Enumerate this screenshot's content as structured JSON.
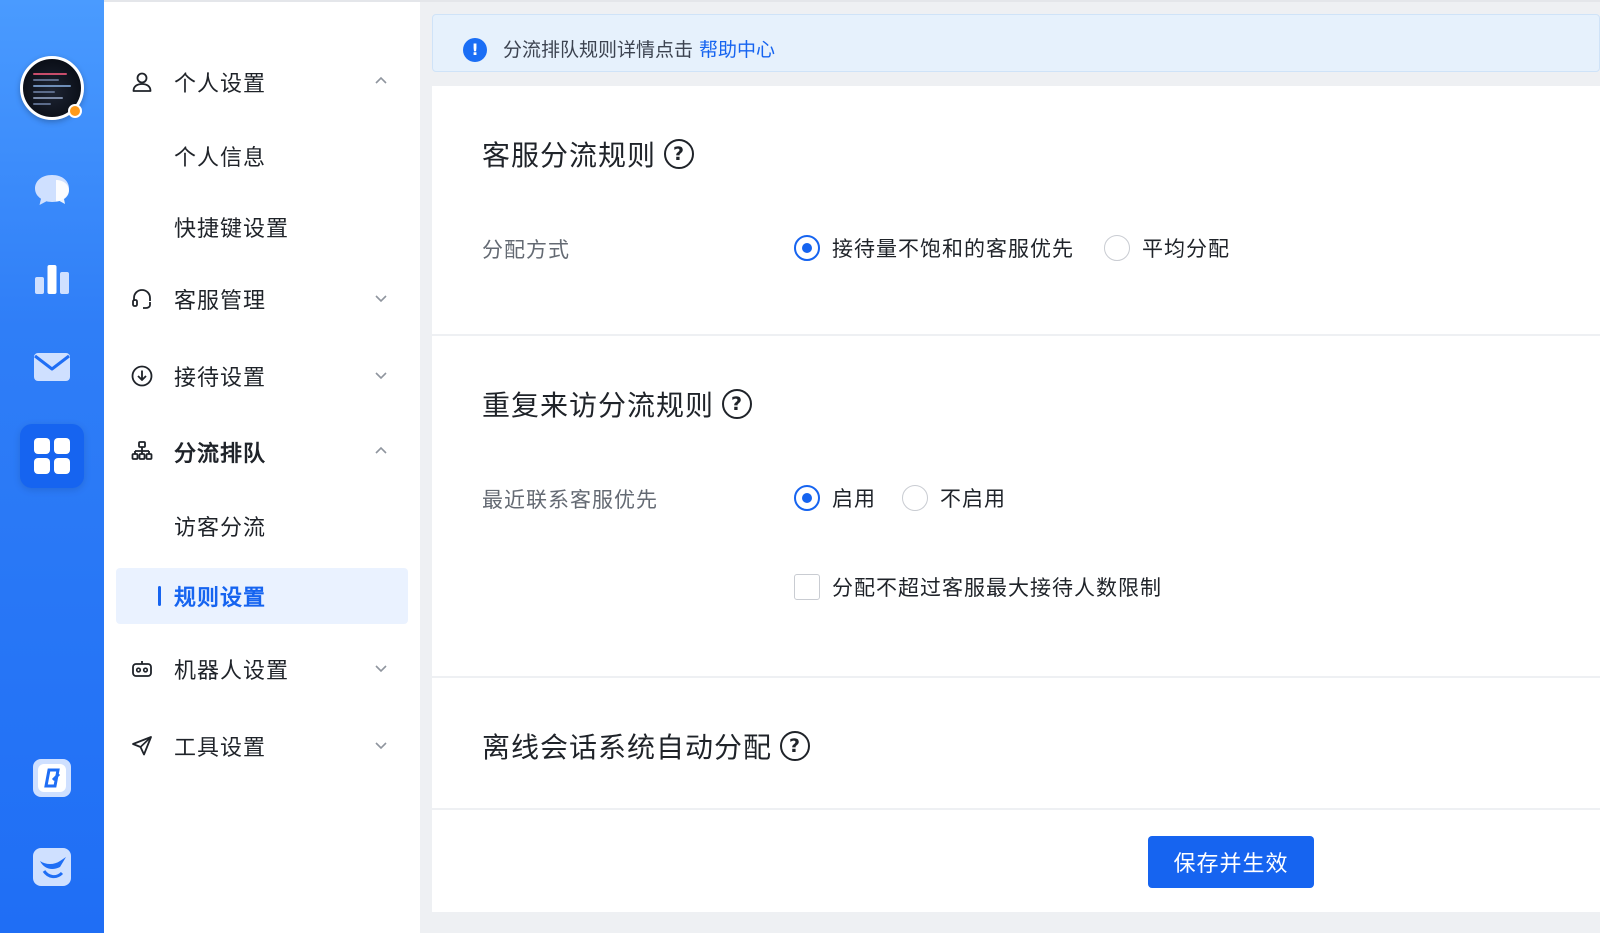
{
  "nav_rail": {
    "icons": [
      "chat-icon",
      "chart-icon",
      "mail-icon",
      "apps-icon",
      "app-logo-icon",
      "bird-icon"
    ]
  },
  "menu": {
    "groups": [
      {
        "label": "个人设置",
        "icon": "user-icon",
        "expanded": true
      },
      {
        "label": "客服管理",
        "icon": "headset-icon",
        "expanded": false
      },
      {
        "label": "接待设置",
        "icon": "download-circle-icon",
        "expanded": false
      },
      {
        "label": "分流排队",
        "icon": "org-chart-icon",
        "expanded": true
      },
      {
        "label": "机器人设置",
        "icon": "robot-icon",
        "expanded": false
      },
      {
        "label": "工具设置",
        "icon": "send-icon",
        "expanded": false
      }
    ],
    "personal_items": [
      "个人信息",
      "快捷键设置"
    ],
    "queue_items": [
      "访客分流",
      "规则设置"
    ]
  },
  "alert": {
    "text": "分流排队规则详情点击 ",
    "link": "帮助中心"
  },
  "sections": {
    "dispatch": {
      "title": "客服分流规则",
      "field_label": "分配方式",
      "options": [
        "接待量不饱和的客服优先",
        "平均分配"
      ],
      "selected": "接待量不饱和的客服优先"
    },
    "revisit": {
      "title": "重复来访分流规则",
      "field_label": "最近联系客服优先",
      "options": [
        "启用",
        "不启用"
      ],
      "selected": "启用",
      "checkbox_label": "分配不超过客服最大接待人数限制",
      "checkbox_checked": false
    },
    "offline": {
      "title": "离线会话系统自动分配"
    }
  },
  "actions": {
    "save_label": "保存并生效"
  },
  "colors": {
    "primary": "#1664f0",
    "rail": "#1f6ef5",
    "alert_bg": "#e6f1fc",
    "status_dot": "#ff9a1a"
  }
}
